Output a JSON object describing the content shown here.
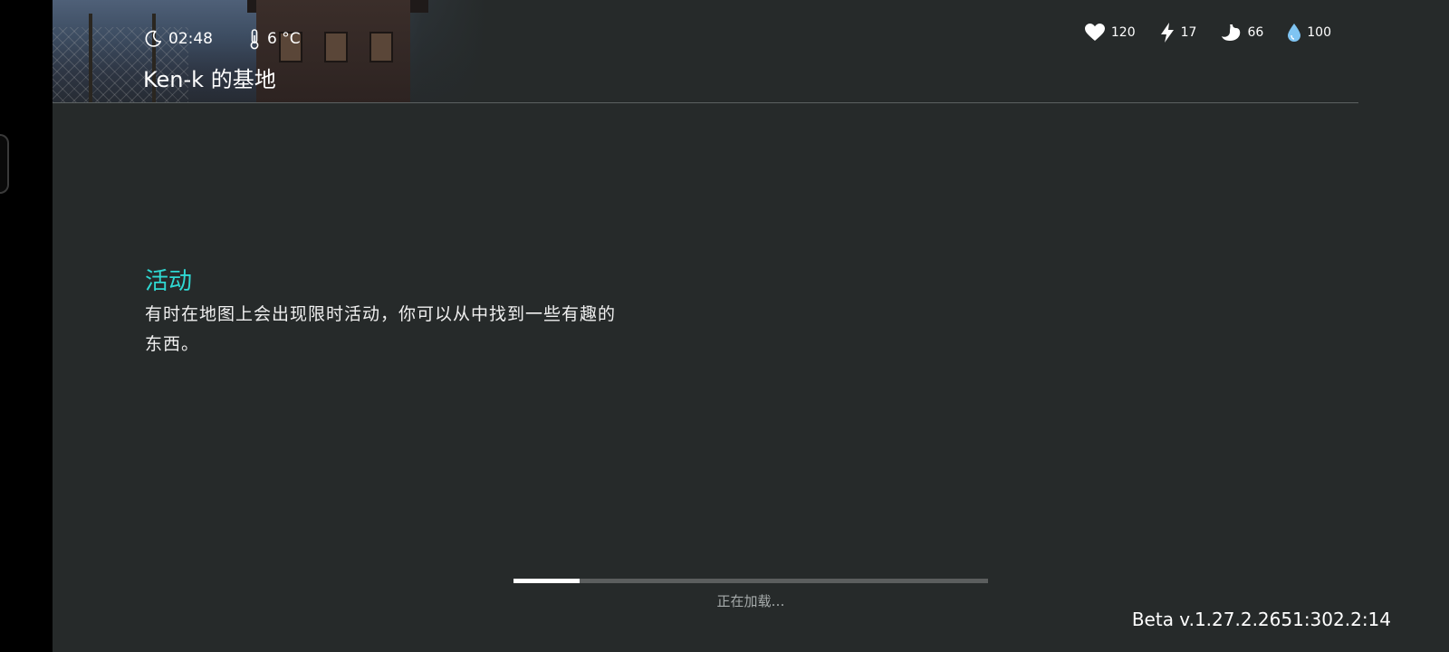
{
  "header": {
    "time": "02:48",
    "temperature": "6 °C",
    "base_name": "Ken-k 的基地"
  },
  "vitals": {
    "health": "120",
    "energy": "17",
    "food": "66",
    "water": "100"
  },
  "tip": {
    "title": "活动",
    "body": "有时在地图上会出现限时活动，你可以从中找到一些有趣的东西。"
  },
  "loading": {
    "label": "正在加载…",
    "progress": 0.14
  },
  "version": "Beta v.1.27.2.2651:302.2:14",
  "colors": {
    "background": "#262a2a",
    "accent": "#2fd8d2",
    "water_icon": "#7fc4f2"
  },
  "icons": {
    "time": "moon-icon",
    "temperature": "thermometer-icon",
    "health": "heart-icon",
    "energy": "lightning-icon",
    "food": "stomach-icon",
    "water": "water-drop-icon"
  }
}
